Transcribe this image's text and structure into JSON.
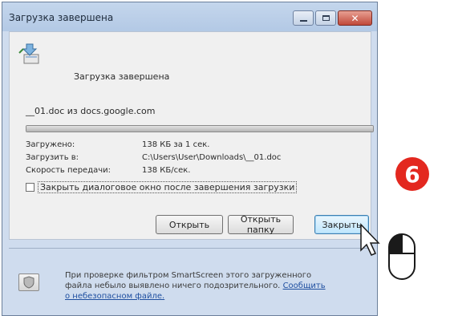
{
  "window": {
    "title": "Загрузка завершена"
  },
  "status": {
    "text": "Загрузка завершена"
  },
  "file": {
    "line": "__01.doc из docs.google.com",
    "progress": 1.0
  },
  "info": [
    {
      "label": "Загружено:",
      "value": "138 КБ за 1 сек."
    },
    {
      "label": "Загрузить в:",
      "value": "C:\\Users\\User\\Downloads\\__01.doc"
    },
    {
      "label": "Скорость передачи:",
      "value": "138 КБ/сек."
    }
  ],
  "checkbox": {
    "label": "Закрыть диалоговое окно после завершения загрузки",
    "checked": false
  },
  "buttons": {
    "open": "Открыть",
    "open_folder": "Открыть папку",
    "close": "Закрыть"
  },
  "footer": {
    "text": "При проверке фильтром SmartScreen этого загруженного файла небыло выявлено ничего подозрительного.",
    "link": "Сообщить о небезопасном файле."
  },
  "step_badge": "6",
  "colors": {
    "badge": "#e3281f",
    "link": "#1f4fa0",
    "title_bar": "#c4d6ec"
  }
}
